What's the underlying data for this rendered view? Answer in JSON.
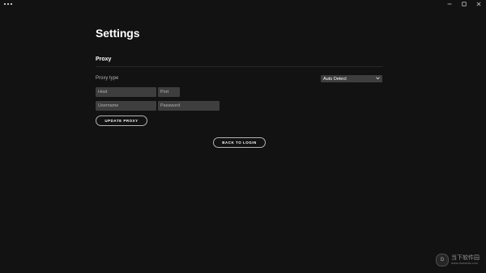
{
  "window": {
    "controls": [
      "minimize-icon",
      "maximize-icon",
      "close-icon"
    ],
    "menu_icon": "more-horizontal-icon"
  },
  "page": {
    "title": "Settings"
  },
  "proxy": {
    "section_title": "Proxy",
    "type_label": "Proxy type",
    "type_selected": "Auto Detect",
    "host_placeholder": "Host",
    "port_placeholder": "Port",
    "username_placeholder": "Username",
    "password_placeholder": "Password",
    "update_button": "UPDATE PROXY"
  },
  "back_button": "BACK TO LOGIN",
  "watermark": {
    "logo_text": "D",
    "name": "当下软件园",
    "url": "www.downxia.com"
  },
  "colors": {
    "background": "#121212",
    "input_bg": "#3e3e3e",
    "text": "#ffffff",
    "muted": "#b3b3b3"
  }
}
